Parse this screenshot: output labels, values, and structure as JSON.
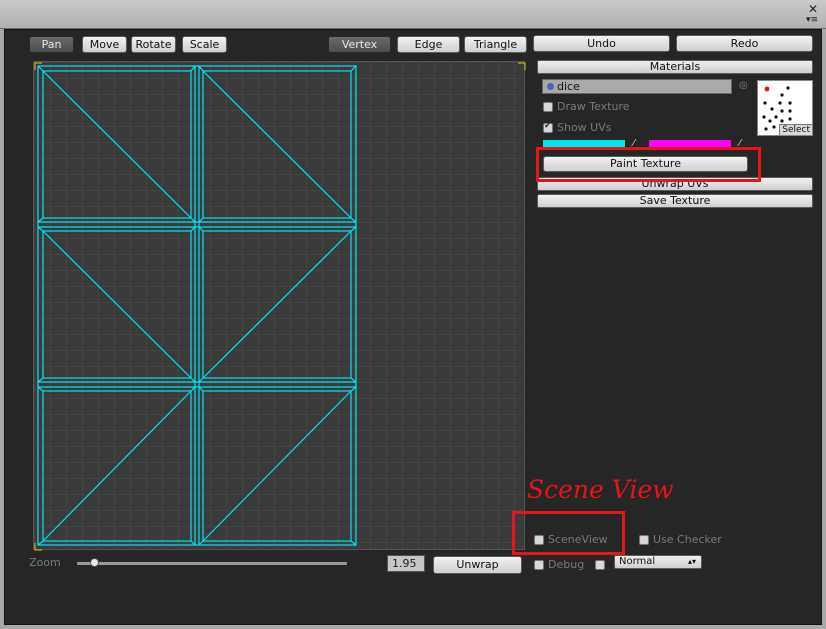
{
  "window": {
    "close_glyph": "✕",
    "menu_glyph": "▾≡"
  },
  "toolbar": {
    "pan": "Pan",
    "move": "Move",
    "rotate": "Rotate",
    "scale": "Scale",
    "vertex": "Vertex",
    "edge": "Edge",
    "triangle": "Triangle",
    "undo": "Undo",
    "redo": "Redo"
  },
  "bottom": {
    "zoom_label": "Zoom",
    "zoom_value": "1.95",
    "unwrap": "Unwrap"
  },
  "materials": {
    "header": "Materials",
    "material_name": "dice",
    "picker_glyph": "◎",
    "draw_texture": "Draw Texture",
    "show_uvs": "Show UVs",
    "paint_texture": "Paint Texture",
    "unwrap_uvs": "Unwrap UVs",
    "save_texture": "Save Texture",
    "thumb_select": "Select",
    "colors": {
      "uv_color": "#00e5f0",
      "selection_color": "#ff00ff"
    }
  },
  "options": {
    "scene_view": "SceneView",
    "use_checker": "Use Checker",
    "debug": "Debug",
    "mode": "Normal"
  },
  "annotation": {
    "text": "Scene View",
    "color": "#e8131b"
  },
  "icons": [
    "close-icon",
    "menu-icon",
    "eyedropper-icon",
    "object-picker-icon",
    "dropdown-arrow-icon"
  ]
}
